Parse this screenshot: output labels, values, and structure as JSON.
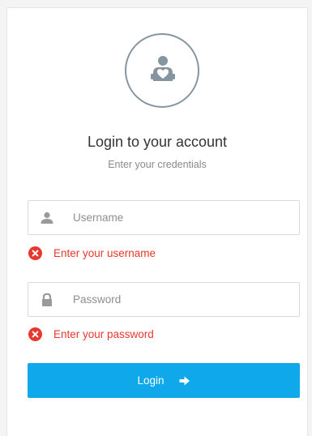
{
  "header": {
    "avatar_icon": "user-love-icon",
    "title": "Login to your account",
    "subtitle": "Enter your credentials"
  },
  "form": {
    "username": {
      "icon": "user-icon",
      "placeholder": "Username",
      "value": "",
      "error": "Enter your username",
      "error_icon": "error-circle-icon"
    },
    "password": {
      "icon": "lock-icon",
      "placeholder": "Password",
      "value": "",
      "error": "Enter your password",
      "error_icon": "error-circle-icon"
    },
    "submit": {
      "label": "Login",
      "icon": "arrow-right-icon"
    }
  },
  "colors": {
    "accent": "#0fa8ea",
    "error": "#e8372e",
    "avatar_stroke": "#8696a0"
  }
}
